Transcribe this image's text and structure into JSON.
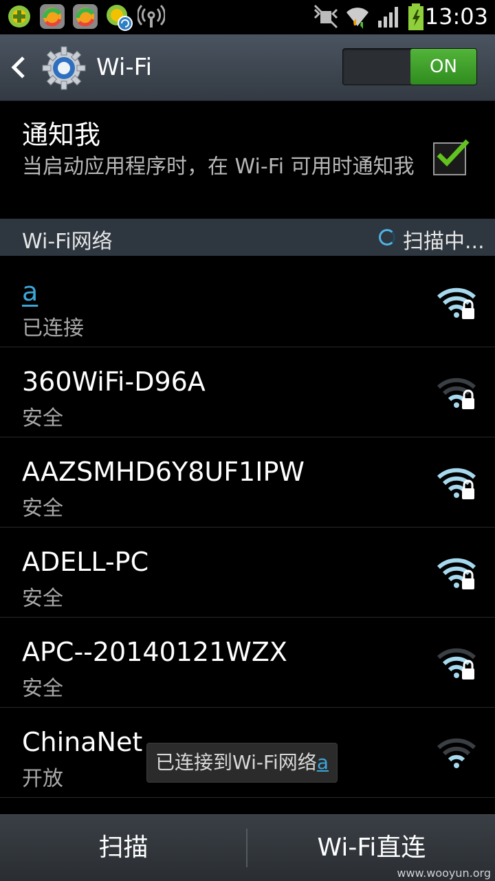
{
  "status_bar": {
    "time": "13:03",
    "icons": [
      "app-notification-icon",
      "browser-notification-icon",
      "browser-notification-icon",
      "app-update-icon",
      "wifi-hotspot-icon",
      "silent-mode-icon",
      "wifi-signal-icon",
      "cell-signal-icon",
      "battery-charging-icon"
    ]
  },
  "action_bar": {
    "title": "Wi-Fi",
    "toggle_label": "ON"
  },
  "notify": {
    "title": "通知我",
    "description": "当启动应用程序时，在 Wi-Fi 可用时通知我",
    "checked": true
  },
  "section": {
    "title": "Wi-Fi网络",
    "scanning_label": "扫描中..."
  },
  "networks": [
    {
      "name": "a",
      "status": "已连接",
      "secured": true,
      "signal": "strong",
      "connected": true
    },
    {
      "name": "360WiFi-D96A",
      "status": "安全",
      "secured": true,
      "signal": "weak",
      "connected": false
    },
    {
      "name": "AAZSMHD6Y8UF1IPW",
      "status": "安全",
      "secured": true,
      "signal": "strong",
      "connected": false
    },
    {
      "name": "ADELL-PC",
      "status": "安全",
      "secured": true,
      "signal": "strong",
      "connected": false
    },
    {
      "name": "APC--20140121WZX",
      "status": "安全",
      "secured": true,
      "signal": "medium",
      "connected": false
    },
    {
      "name": "ChinaNet",
      "status": "开放",
      "secured": false,
      "signal": "weak",
      "connected": false
    }
  ],
  "toast": {
    "prefix": "已连接到Wi-Fi网络",
    "network": "a"
  },
  "bottom_bar": {
    "scan_label": "扫描",
    "direct_label": "Wi-Fi直连"
  },
  "watermark": "www.wooyun.org",
  "colors": {
    "accent": "#3ba7db",
    "toggle_on": "#3f9f2a",
    "check": "#62c21f"
  }
}
